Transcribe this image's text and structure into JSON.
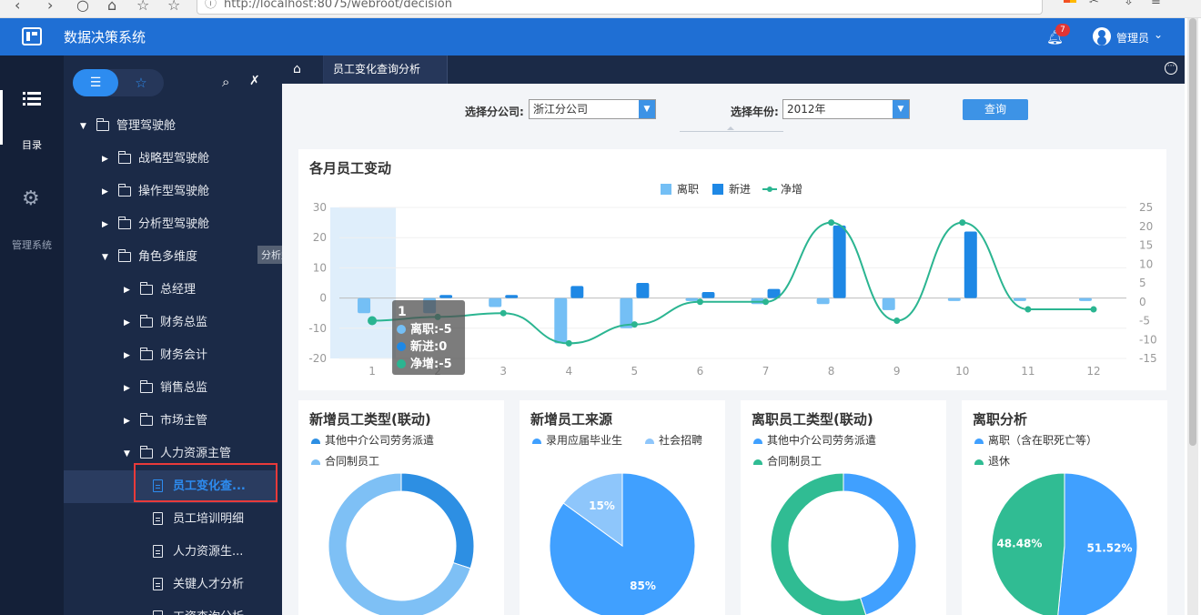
{
  "browser": {
    "url": "http://localhost:8075/webroot/decision"
  },
  "header": {
    "title": "数据决策系统",
    "notification_count": "7",
    "user_name": "管理员"
  },
  "rail": {
    "catalog_label": "目录",
    "manage_label": "管理系统"
  },
  "sidebar": {
    "tree": [
      {
        "label": "管理驾驶舱",
        "level": 0,
        "type": "folder",
        "expanded": true
      },
      {
        "label": "战略型驾驶舱",
        "level": 1,
        "type": "folder",
        "expanded": false
      },
      {
        "label": "操作型驾驶舱",
        "level": 1,
        "type": "folder",
        "expanded": false
      },
      {
        "label": "分析型驾驶舱",
        "level": 1,
        "type": "folder",
        "expanded": false
      },
      {
        "label": "角色多维度",
        "level": 1,
        "type": "folder",
        "expanded": true
      },
      {
        "label": "总经理",
        "level": 2,
        "type": "folder",
        "expanded": false
      },
      {
        "label": "财务总监",
        "level": 2,
        "type": "folder",
        "expanded": false
      },
      {
        "label": "财务会计",
        "level": 2,
        "type": "folder",
        "expanded": false
      },
      {
        "label": "销售总监",
        "level": 2,
        "type": "folder",
        "expanded": false
      },
      {
        "label": "市场主管",
        "level": 2,
        "type": "folder",
        "expanded": false
      },
      {
        "label": "人力资源主管",
        "level": 2,
        "type": "folder",
        "expanded": true
      },
      {
        "label": "员工变化查...",
        "level": 3,
        "type": "doc",
        "active": true
      },
      {
        "label": "员工培训明细",
        "level": 3,
        "type": "doc"
      },
      {
        "label": "人力资源生...",
        "level": 3,
        "type": "doc"
      },
      {
        "label": "关键人才分析",
        "level": 3,
        "type": "doc"
      },
      {
        "label": "工资查询分析",
        "level": 3,
        "type": "doc"
      }
    ],
    "hover_tooltip": "分析型驾驶舱"
  },
  "tabs": {
    "active_label": "员工变化查询分析"
  },
  "filters": {
    "branch_label": "选择分公司:",
    "branch_value": "浙江分公司",
    "year_label": "选择年份:",
    "year_value": "2012年",
    "query_label": "查询"
  },
  "chart_data": [
    {
      "type": "bar",
      "title": "各月员工变动",
      "categories": [
        "1",
        "2",
        "3",
        "4",
        "5",
        "6",
        "7",
        "8",
        "9",
        "10",
        "11",
        "12"
      ],
      "series": [
        {
          "name": "离职",
          "kind": "bar",
          "axis": "left",
          "values": [
            -5,
            -5,
            -3,
            -15,
            -10,
            -1,
            -2,
            -2,
            -4,
            -1,
            -1,
            -1
          ]
        },
        {
          "name": "新进",
          "kind": "bar",
          "axis": "left",
          "values": [
            0,
            1,
            1,
            4,
            5,
            2,
            3,
            24,
            0,
            22,
            0,
            0
          ]
        },
        {
          "name": "净增",
          "kind": "line",
          "axis": "right",
          "values": [
            -5,
            -4,
            -3,
            -11,
            -6,
            0,
            0,
            21,
            -5,
            21,
            -2,
            -2
          ]
        }
      ],
      "ylim_left": [
        -20,
        30
      ],
      "yticks_left": [
        -20,
        -10,
        0,
        10,
        20,
        30
      ],
      "ylim_right": [
        -15,
        25
      ],
      "yticks_right": [
        -15,
        -10,
        -5,
        0,
        5,
        10,
        15,
        20,
        25
      ],
      "colors": {
        "离职": "#74bff5",
        "新进": "#1e88e5",
        "净增": "#2bb591"
      },
      "legend_position": "top-center",
      "tooltip": {
        "title": "1",
        "rows": [
          "离职:-5",
          "新进:0",
          "净增:-5"
        ]
      },
      "highlight_category": "1"
    },
    {
      "type": "pie",
      "title": "新增员工类型(联动)",
      "donut": true,
      "labels": [
        "其他中介公司劳务派遣",
        "合同制员工"
      ],
      "values": [
        30,
        70
      ],
      "colors": [
        "#2d8fe3",
        "#7ec0f5"
      ]
    },
    {
      "type": "pie",
      "title": "新增员工来源",
      "donut": false,
      "labels": [
        "录用应届毕业生",
        "社会招聘"
      ],
      "values": [
        85,
        15
      ],
      "value_labels": [
        "85%",
        "15%"
      ],
      "colors": [
        "#40a0ff",
        "#8ec6fb"
      ]
    },
    {
      "type": "pie",
      "title": "离职员工类型(联动)",
      "donut": true,
      "labels": [
        "其他中介公司劳务派遣",
        "合同制员工"
      ],
      "values": [
        45,
        55
      ],
      "colors": [
        "#40a0ff",
        "#30bc93"
      ]
    },
    {
      "type": "pie",
      "title": "离职分析",
      "donut": false,
      "labels": [
        "离职（含在职死亡等）",
        "退休"
      ],
      "values": [
        51.52,
        48.48
      ],
      "value_labels": [
        "51.52%",
        "48.48%"
      ],
      "colors": [
        "#40a0ff",
        "#30bc93"
      ]
    }
  ]
}
